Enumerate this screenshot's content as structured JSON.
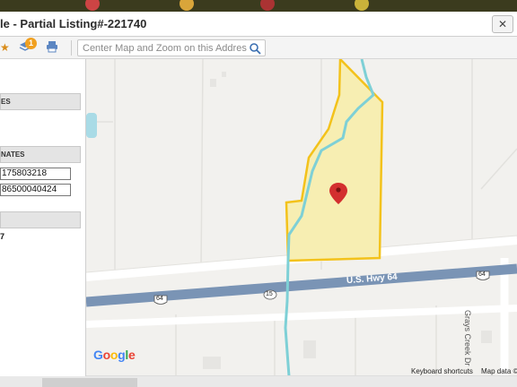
{
  "dialog": {
    "title": "le - Partial Listing#-221740",
    "close_label": "✕"
  },
  "toolbar": {
    "badge_count": "1",
    "search_placeholder": "Center Map and Zoom on this Address"
  },
  "sidebar": {
    "section1_header": "ES",
    "section2_header": "NATES",
    "latitude_value": "175803218",
    "longitude_value": "86500040424",
    "small_value": "7"
  },
  "map": {
    "road_label": "U.S. Hwy 64",
    "shield_64": "64",
    "shield_15": "15",
    "street_label": "Grays Creek Dr",
    "google_letters": [
      "G",
      "o",
      "o",
      "g",
      "l",
      "e"
    ],
    "keyboard_shortcuts": "Keyboard shortcuts",
    "map_data": "Map data ©",
    "colors": {
      "parcel_fill": "#f7eeb2",
      "parcel_stroke": "#f3c21b",
      "creek": "#7ed0d6",
      "highway": "#7a94b5",
      "pin": "#d32f2f"
    }
  }
}
